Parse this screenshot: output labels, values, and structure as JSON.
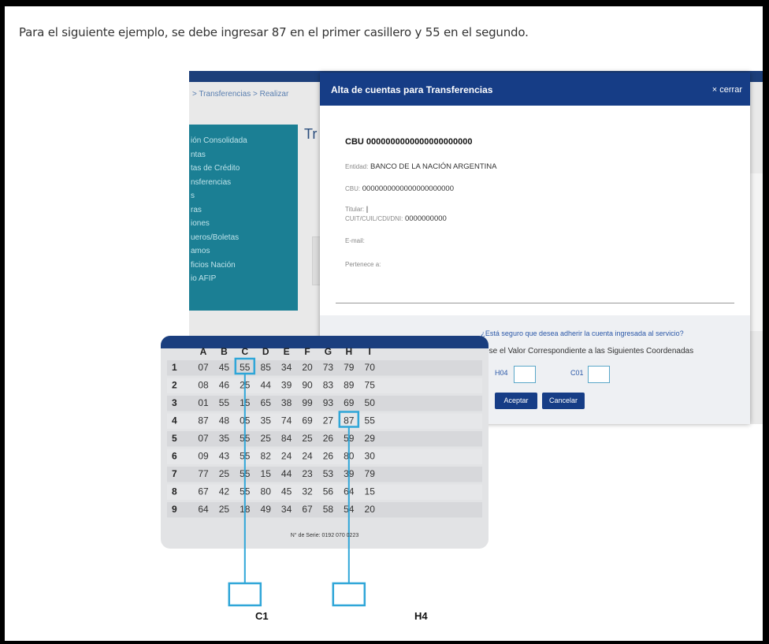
{
  "instruction": "Para el siguiente ejemplo, se debe ingresar 87 en el primer casillero y 55 en el segundo.",
  "background": {
    "breadcrumb": "> Transferencias > Realizar",
    "page_title": "Tr",
    "sidebar_items": [
      "ión Consolidada",
      "ntas",
      "tas de Crédito",
      "nsferencias",
      "s",
      "ras",
      "iones",
      "ueros/Boletas",
      "amos",
      "ficios Nación",
      "io AFIP"
    ]
  },
  "modal": {
    "title": "Alta de cuentas para Transferencias",
    "close_label": "× cerrar",
    "cbu_main": "CBU 0000000000000000000000",
    "entity_label": "Entidad:",
    "entity_value": "BANCO DE LA NACIÓN ARGENTINA",
    "cbu_label": "CBU:",
    "cbu_value": "0000000000000000000000",
    "holder_label": "Titular:",
    "holder_value": "|",
    "cuit_label": "CUIT/CUIL/CDI/DNI:",
    "cuit_value": "0000000000",
    "email_label": "E-mail:",
    "belongs_label": "Pertenece a:",
    "confirm_question": "¿Está seguro que desea adherir la cuenta ingresada al servicio?",
    "coord_prompt": "Ingrese el Valor Correspondiente a las Siguientes Coordenadas",
    "coord1_label": "H04",
    "coord2_label": "C01",
    "coord1_value": "",
    "coord2_value": "",
    "accept_label": "Aceptar",
    "cancel_label": "Cancelar"
  },
  "card": {
    "columns": [
      "A",
      "B",
      "C",
      "D",
      "E",
      "F",
      "G",
      "H",
      "I"
    ],
    "rows": [
      {
        "n": "1",
        "v": [
          "07",
          "45",
          "55",
          "85",
          "34",
          "20",
          "73",
          "79",
          "70"
        ]
      },
      {
        "n": "2",
        "v": [
          "08",
          "46",
          "25",
          "44",
          "39",
          "90",
          "83",
          "89",
          "75"
        ]
      },
      {
        "n": "3",
        "v": [
          "01",
          "55",
          "15",
          "65",
          "38",
          "99",
          "93",
          "69",
          "50"
        ]
      },
      {
        "n": "4",
        "v": [
          "87",
          "48",
          "05",
          "35",
          "74",
          "69",
          "27",
          "87",
          "55"
        ]
      },
      {
        "n": "5",
        "v": [
          "07",
          "35",
          "55",
          "25",
          "84",
          "25",
          "26",
          "59",
          "29"
        ]
      },
      {
        "n": "6",
        "v": [
          "09",
          "43",
          "55",
          "82",
          "24",
          "24",
          "26",
          "80",
          "30"
        ]
      },
      {
        "n": "7",
        "v": [
          "77",
          "25",
          "55",
          "15",
          "44",
          "23",
          "53",
          "39",
          "79"
        ]
      },
      {
        "n": "8",
        "v": [
          "67",
          "42",
          "55",
          "80",
          "45",
          "32",
          "56",
          "64",
          "15"
        ]
      },
      {
        "n": "9",
        "v": [
          "64",
          "25",
          "18",
          "49",
          "34",
          "67",
          "58",
          "54",
          "20"
        ]
      }
    ],
    "serial": "N° de Serie: 0192 070 0223",
    "highlight_color": "#2fa6d8"
  },
  "callouts": {
    "c1_label": "C1",
    "h4_label": "H4"
  }
}
